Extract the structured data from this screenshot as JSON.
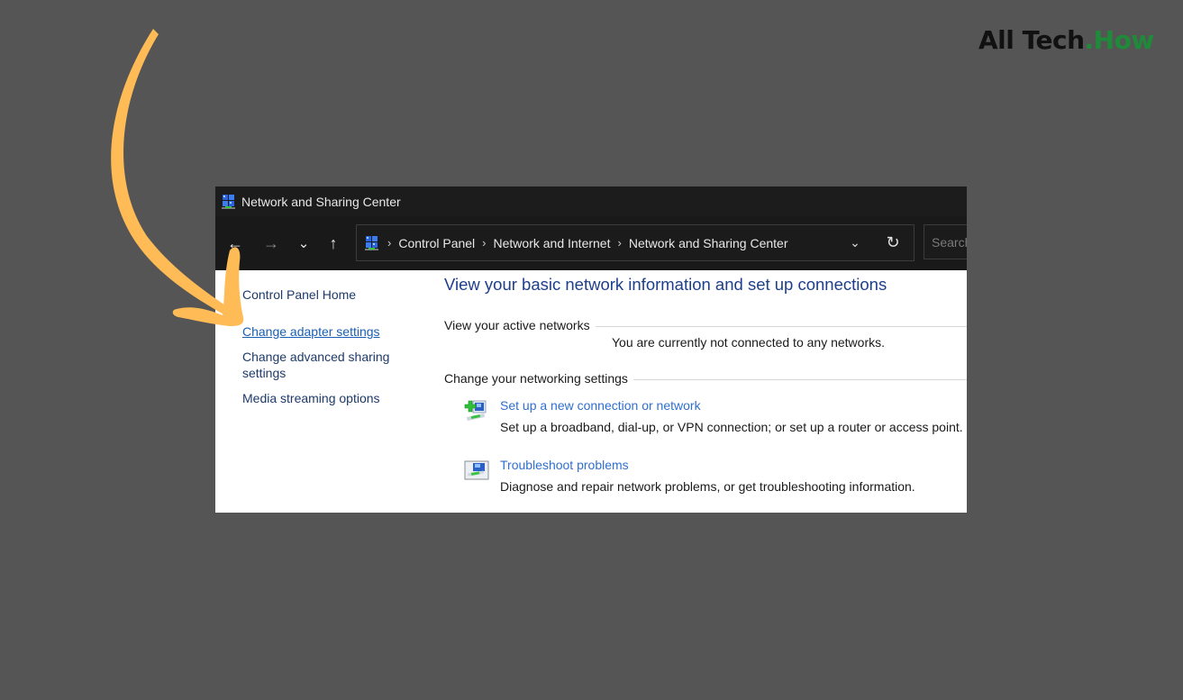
{
  "brand": {
    "name_main": "All Tech",
    "name_accent": ".How",
    "accent_color": "#1f8a3a"
  },
  "annotation": {
    "arrow_color": "#ffbb55",
    "points_to": "Change adapter settings"
  },
  "window": {
    "title": "Network and Sharing Center",
    "title_icon": "network-sharing-center-icon",
    "nav": {
      "back_icon": "←",
      "forward_icon": "→",
      "recent_icon": "⌄",
      "up_icon": "↑"
    },
    "address": {
      "icon": "network-sharing-center-icon",
      "separator": "›",
      "breadcrumbs": [
        "Control Panel",
        "Network and Internet",
        "Network and Sharing Center"
      ],
      "dropdown_icon": "⌄",
      "refresh_icon": "↻"
    },
    "search": {
      "placeholder": "Search Control Panel",
      "value": ""
    }
  },
  "sidebar": {
    "items": [
      {
        "label": "Control Panel Home",
        "style": "normal"
      },
      {
        "label": "Change adapter settings",
        "style": "hovered-link"
      },
      {
        "label": "Change advanced sharing",
        "label_line2": "settings",
        "style": "normal"
      },
      {
        "label": "Media streaming options",
        "style": "normal"
      }
    ]
  },
  "main": {
    "title": "View your basic network information and set up connections",
    "active_networks": {
      "heading": "View your active networks",
      "status": "You are currently not connected to any networks."
    },
    "networking_settings": {
      "heading": "Change your networking settings",
      "tasks": [
        {
          "icon": "new-connection-icon",
          "link": "Set up a new connection or network",
          "description": "Set up a broadband, dial-up, or VPN connection; or set up a router or access point."
        },
        {
          "icon": "troubleshoot-icon",
          "link": "Troubleshoot problems",
          "description": "Diagnose and repair network problems, or get troubleshooting information."
        }
      ]
    }
  }
}
